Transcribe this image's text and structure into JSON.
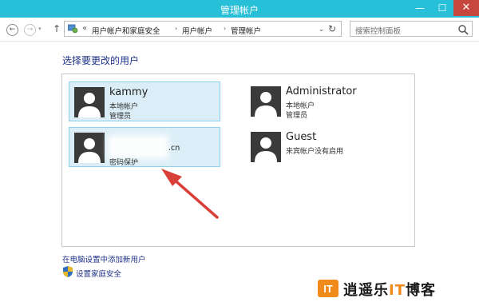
{
  "window": {
    "title": "管理帐户",
    "min_glyph": "—",
    "max_glyph": "☐",
    "close_glyph": "✕"
  },
  "nav": {
    "back_glyph": "←",
    "forward_glyph": "→",
    "forward_dropdown_glyph": "▾",
    "up_glyph": "↑"
  },
  "address": {
    "icon": "control-panel-icon",
    "lead": "«",
    "crumbs": [
      "用户帐户和家庭安全",
      "用户帐户",
      "管理帐户"
    ],
    "sep": "›",
    "dropdown_glyph": "⌄",
    "refresh_glyph": "↻"
  },
  "search": {
    "placeholder": "搜索控制面板",
    "icon": "search-icon"
  },
  "heading": "选择要更改的用户",
  "accounts": [
    {
      "name": "kammy",
      "line1": "本地帐户",
      "line2": "管理员",
      "selected": true
    },
    {
      "name": "Administrator",
      "line1": "本地帐户",
      "line2": "管理员",
      "selected": false
    },
    {
      "name_suffix": ".cn",
      "line1": "密码保护",
      "selected": true,
      "name_obscured": true
    },
    {
      "name": "Guest",
      "line1": "来宾帐户没有启用",
      "selected": false
    }
  ],
  "links": {
    "add_user": "在电脑设置中添加新用户",
    "family_safety": "设置家庭安全"
  },
  "watermark": {
    "badge": "IT",
    "text_a": "逍遥乐",
    "text_it": "IT",
    "text_b": "博客"
  },
  "colors": {
    "titlebar": "#28bfd8",
    "close": "#c7463e",
    "tile_selected_bg": "#dbeef7",
    "tile_selected_border": "#8fd0ec",
    "link": "#1e3287",
    "arrow": "#d9403a",
    "logo_accent": "#f08a1a"
  }
}
